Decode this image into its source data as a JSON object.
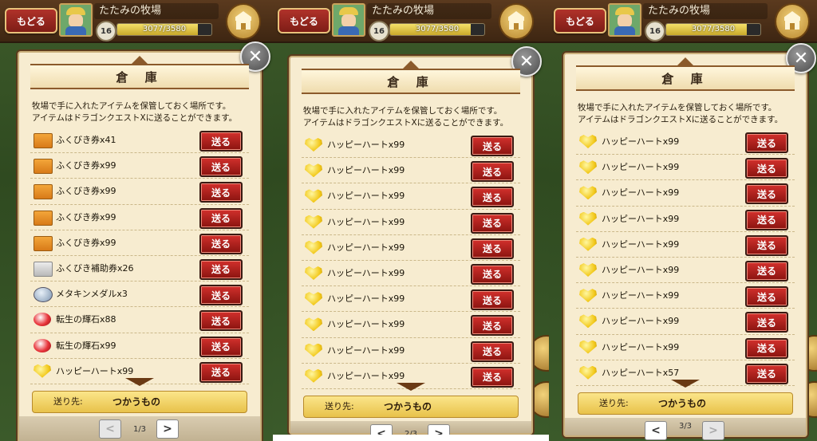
{
  "header": {
    "back_label": "もどる",
    "farm_name": "たたみの牧場",
    "level": "16",
    "exp_text": "3077/3580",
    "exp_progress": 0.86,
    "barn_icon": "barn-icon"
  },
  "modal": {
    "title": "倉 庫",
    "description_line1": "牧場で手に入れたアイテムを保管しておく場所です。",
    "description_line2": "アイテムはドラゴンクエストXに送ることができます。",
    "send_label": "送る",
    "dest_label": "送り先:",
    "dest_value": "つかうもの",
    "prev_label": "<",
    "next_label": ">"
  },
  "pages": [
    {
      "indicator": "1/3",
      "items": [
        {
          "name": "ふくびき券x41",
          "icon": "ticket-icon"
        },
        {
          "name": "ふくびき券x99",
          "icon": "ticket-icon"
        },
        {
          "name": "ふくびき券x99",
          "icon": "ticket-icon"
        },
        {
          "name": "ふくびき券x99",
          "icon": "ticket-icon"
        },
        {
          "name": "ふくびき券x99",
          "icon": "ticket-icon"
        },
        {
          "name": "ふくびき補助券x26",
          "icon": "ticket-silver-icon"
        },
        {
          "name": "メタキンメダルx3",
          "icon": "medal-icon"
        },
        {
          "name": "転生の輝石x88",
          "icon": "red-stone-icon"
        },
        {
          "name": "転生の輝石x99",
          "icon": "red-stone-icon"
        },
        {
          "name": "ハッピーハートx99",
          "icon": "heart-icon"
        }
      ]
    },
    {
      "indicator": "2/3",
      "items": [
        {
          "name": "ハッピーハートx99",
          "icon": "heart-icon"
        },
        {
          "name": "ハッピーハートx99",
          "icon": "heart-icon"
        },
        {
          "name": "ハッピーハートx99",
          "icon": "heart-icon"
        },
        {
          "name": "ハッピーハートx99",
          "icon": "heart-icon"
        },
        {
          "name": "ハッピーハートx99",
          "icon": "heart-icon"
        },
        {
          "name": "ハッピーハートx99",
          "icon": "heart-icon"
        },
        {
          "name": "ハッピーハートx99",
          "icon": "heart-icon"
        },
        {
          "name": "ハッピーハートx99",
          "icon": "heart-icon"
        },
        {
          "name": "ハッピーハートx99",
          "icon": "heart-icon"
        },
        {
          "name": "ハッピーハートx99",
          "icon": "heart-icon"
        }
      ]
    },
    {
      "indicator": "3/3",
      "items": [
        {
          "name": "ハッピーハートx99",
          "icon": "heart-icon"
        },
        {
          "name": "ハッピーハートx99",
          "icon": "heart-icon"
        },
        {
          "name": "ハッピーハートx99",
          "icon": "heart-icon"
        },
        {
          "name": "ハッピーハートx99",
          "icon": "heart-icon"
        },
        {
          "name": "ハッピーハートx99",
          "icon": "heart-icon"
        },
        {
          "name": "ハッピーハートx99",
          "icon": "heart-icon"
        },
        {
          "name": "ハッピーハートx99",
          "icon": "heart-icon"
        },
        {
          "name": "ハッピーハートx99",
          "icon": "heart-icon"
        },
        {
          "name": "ハッピーハートx99",
          "icon": "heart-icon"
        },
        {
          "name": "ハッピーハートx57",
          "icon": "heart-icon"
        }
      ]
    }
  ]
}
